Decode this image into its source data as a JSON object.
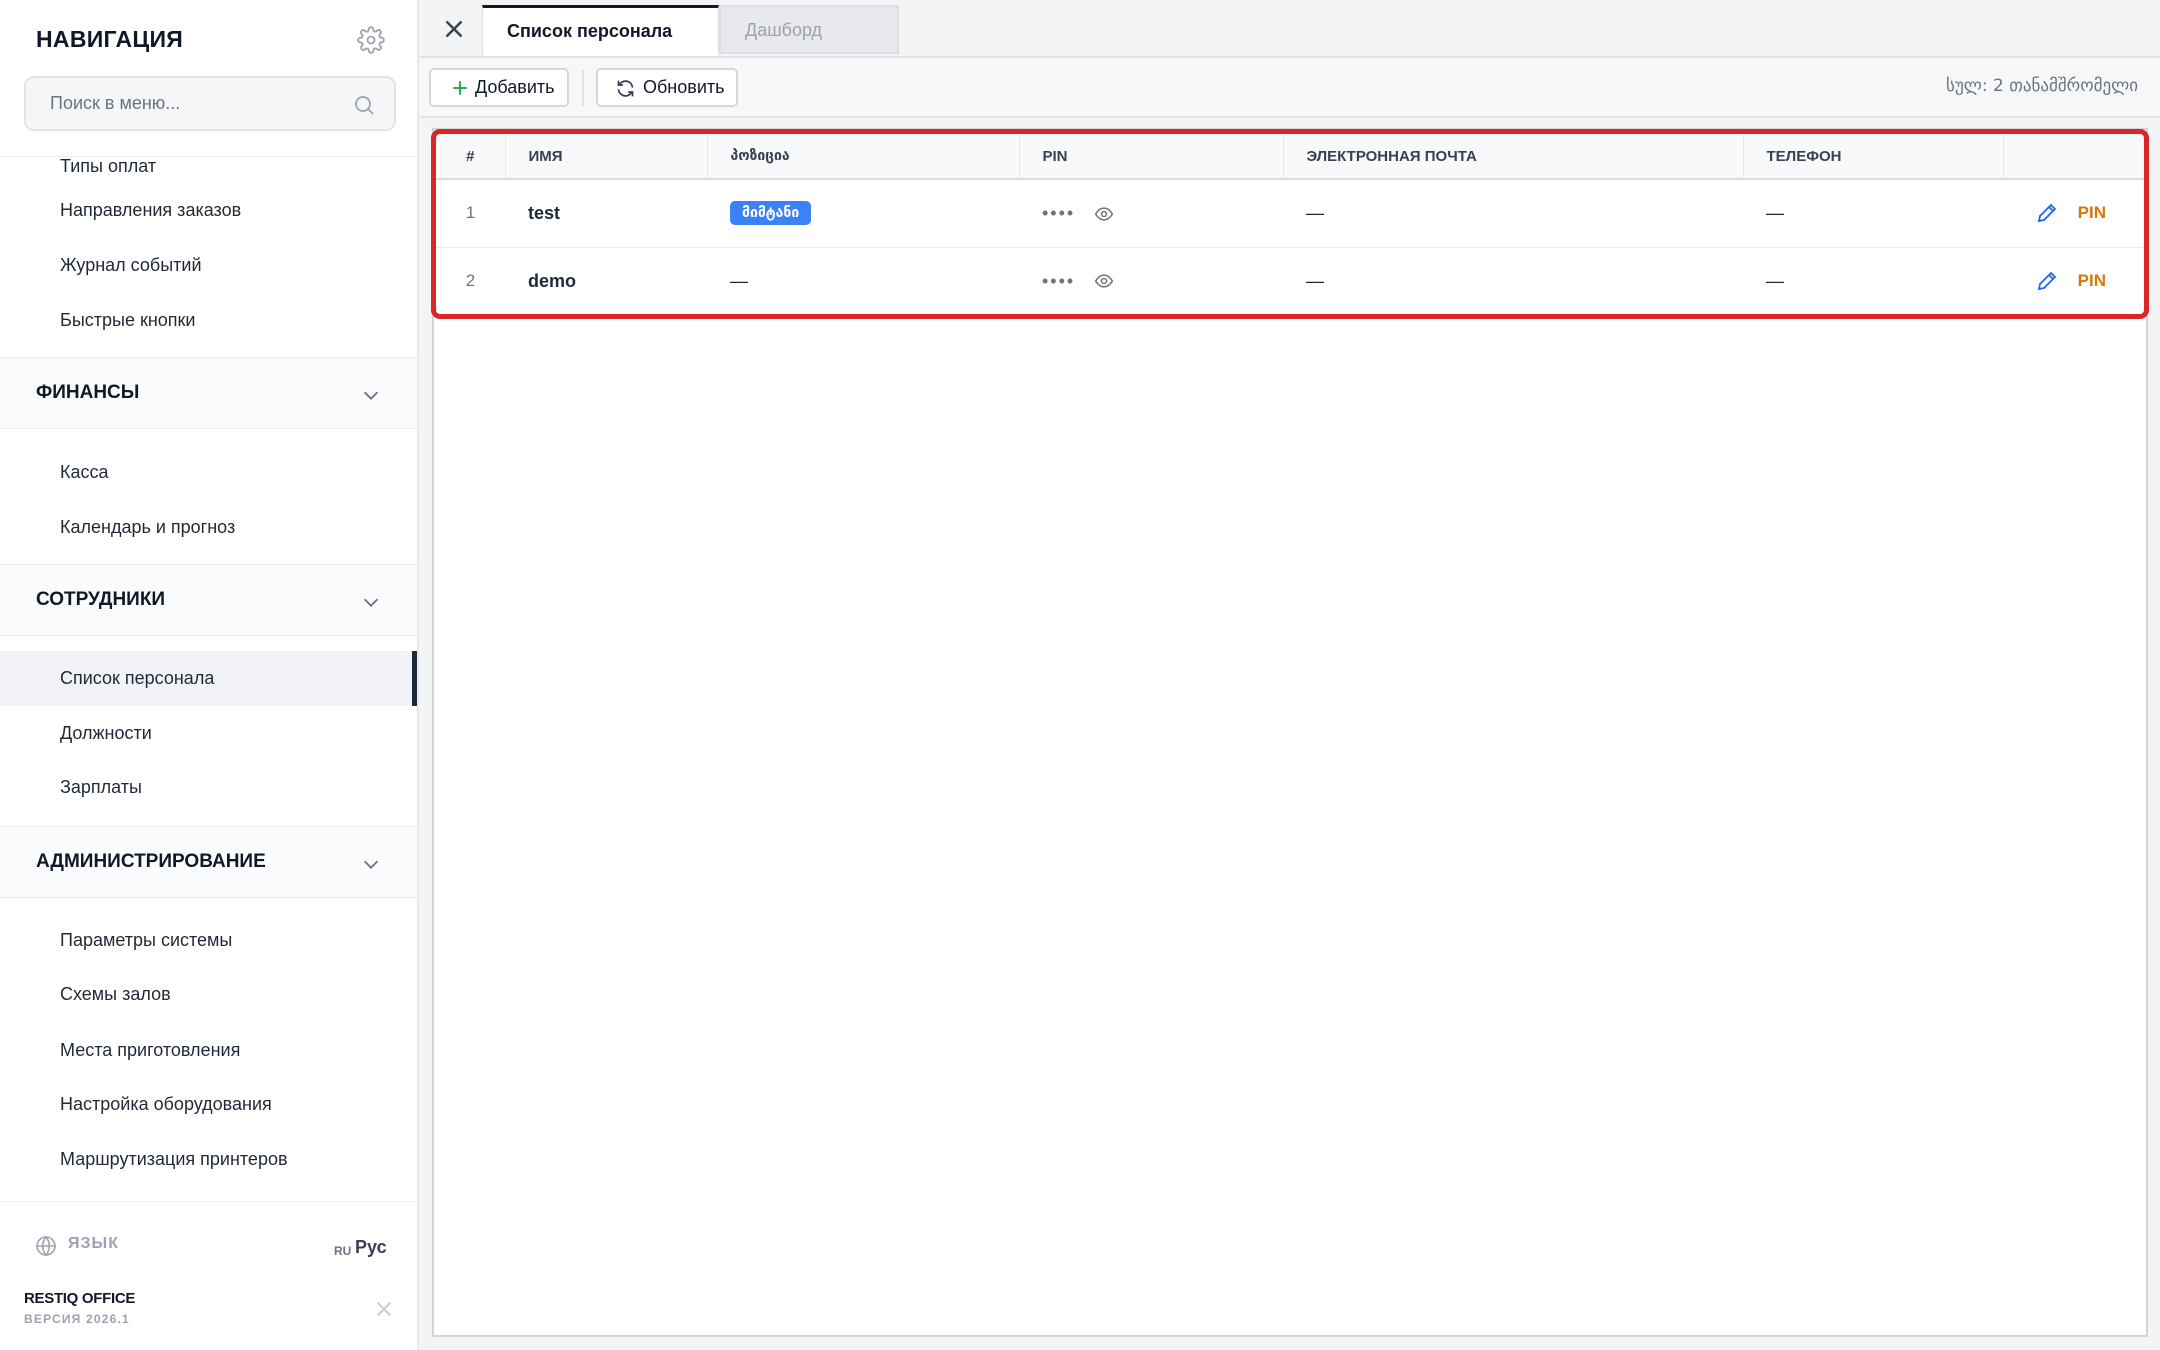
{
  "sidebar": {
    "title": "НАВИГАЦИЯ",
    "search_placeholder": "Поиск в меню...",
    "cut_item": "Типы оплат",
    "group_top_items": [
      "Направления заказов",
      "Журнал событий",
      "Быстрые кнопки"
    ],
    "sections": [
      {
        "label": "ФИНАНСЫ",
        "items": [
          "Касса",
          "Календарь и прогноз"
        ]
      },
      {
        "label": "СОТРУДНИКИ",
        "items": [
          "Список персонала",
          "Должности",
          "Зарплаты"
        ],
        "active_item": "Список персонала"
      },
      {
        "label": "АДМИНИСТРИРОВАНИЕ",
        "items": [
          "Параметры системы",
          "Схемы залов",
          "Места приготовления",
          "Настройка оборудования",
          "Маршрутизация принтеров"
        ]
      }
    ],
    "footer": {
      "language_label": "ЯЗЫК",
      "language_code": "RU",
      "language_name": "Рус",
      "brand": "RESTIQ OFFICE",
      "version": "ВЕРСИЯ 2026.1"
    }
  },
  "tabs": [
    {
      "label": "Список персонала",
      "active": true
    },
    {
      "label": "Дашборд",
      "active": false
    }
  ],
  "toolbar": {
    "add_label": "Добавить",
    "refresh_label": "Обновить",
    "total_text": "სულ: 2 თანამშრომელი"
  },
  "table": {
    "columns": [
      "#",
      "ИМЯ",
      "პოზიცია",
      "PIN",
      "ЭЛЕКТРОННАЯ ПОЧТА",
      "ТЕЛЕФОН",
      ""
    ],
    "rows": [
      {
        "num": "1",
        "name": "test",
        "position": "მიმტანი",
        "pin": "••••",
        "email": "—",
        "phone": "—",
        "action": "PIN"
      },
      {
        "num": "2",
        "name": "demo",
        "position": "—",
        "pin": "••••",
        "email": "—",
        "phone": "—",
        "action": "PIN"
      }
    ]
  },
  "colors": {
    "accent": "#3b82f6",
    "pin_action": "#d97706",
    "highlight": "#dc2626"
  }
}
